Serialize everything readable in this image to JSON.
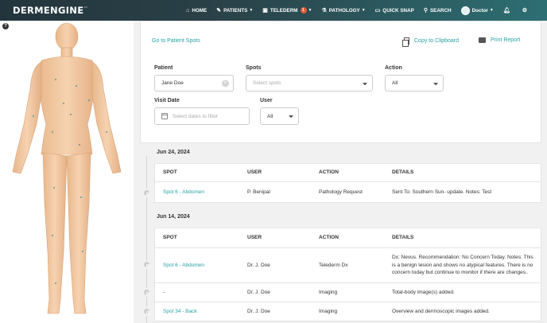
{
  "brand": {
    "name": "DERMENGINE",
    "tm": "™"
  },
  "nav": {
    "home": "HOME",
    "patients": "PATIENTS",
    "telederm": "TELEDERM",
    "telederm_count": "1",
    "pathology": "PATHOLOGY",
    "quick_snap": "QUICK SNAP",
    "search": "SEARCH",
    "user": "Doctor"
  },
  "actions": {
    "goto_patient_spots": "Go to Patient Spots",
    "copy_clipboard": "Copy to Clipboard",
    "print_report": "Print Report"
  },
  "filters": {
    "patient_label": "Patient",
    "patient_value": "Jane Doe",
    "spots_label": "Spots",
    "spots_placeholder": "Select spots",
    "action_label": "Action",
    "action_value": "All",
    "visit_date_label": "Visit Date",
    "visit_date_placeholder": "Select dates to filter",
    "user_label": "User",
    "user_value": "All"
  },
  "columns": {
    "spot": "SPOT",
    "user": "USER",
    "action": "ACTION",
    "details": "DETAILS"
  },
  "groups": [
    {
      "date": "Jun 24, 2024",
      "rows": [
        {
          "spot": "Spot 6 - Abdomen",
          "user": "P. Benipal",
          "action": "Pathology Request",
          "details": "Sent To: Southern Sun- update. Notes: Test"
        }
      ]
    },
    {
      "date": "Jun 14, 2024",
      "rows": [
        {
          "spot": "Spot 6 - Abdomen",
          "user": "Dr. J. Doe",
          "action": "Telederm Dx",
          "details": "Dx: Nevus. Recommendation: No Concern Today. Notes: This is a benign lesion and shows no atypical features. There is no concern today but continue to monitor if there are changes.."
        },
        {
          "spot": "-",
          "user": "Dr. J. Doe",
          "action": "Imaging",
          "details": "Total-body image(s) added."
        },
        {
          "spot": "Spot 34 - Back",
          "user": "Dr. J. Doe",
          "action": "Imaging",
          "details": "Overview and dermoscopic images added."
        }
      ]
    }
  ],
  "colors": {
    "accent": "#26a3a6",
    "nav_dark": "#23353c",
    "nav_teal": "#2c6f73",
    "badge": "#e05a3c"
  }
}
